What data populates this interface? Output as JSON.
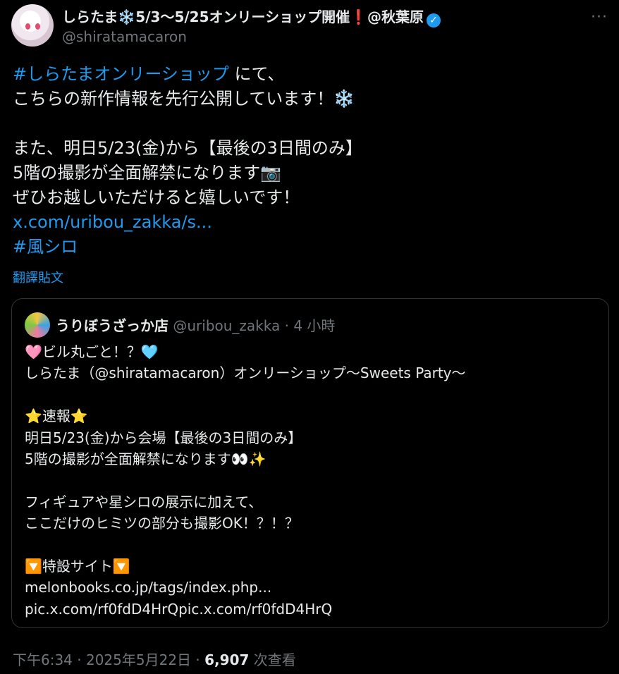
{
  "author": {
    "name": "しらたま❄️5/3～5/25オンリーショップ開催❗️@秋葉原",
    "handle": "@shiratamacaron",
    "more_icon": "more-dots-icon"
  },
  "tweet": {
    "lines": [
      {
        "type": "mixed",
        "link": "#しらたまオンリーショップ",
        "text": " にて、"
      },
      {
        "type": "text",
        "text": "こちらの新作情報を先行公開しています！❄️"
      },
      {
        "type": "blank",
        "text": ""
      },
      {
        "type": "text",
        "text": "また、明日5/23(金)から【最後の3日間のみ】"
      },
      {
        "type": "text",
        "text": "5階の撮影が全面解禁になります📷"
      },
      {
        "type": "text",
        "text": "ぜひお越しいただけると嬉しいです！"
      },
      {
        "type": "link",
        "text": "x.com/uribou_zakka/s..."
      },
      {
        "type": "link",
        "text": "#風シロ"
      }
    ],
    "translate": "翻譯貼文"
  },
  "quote": {
    "name": "うりぼうざっか店",
    "handle": "@uribou_zakka",
    "time": " · 4 小時",
    "lines": [
      "🩷ビル丸ごと！？🩵",
      "しらたま（@shiratamacaron）オンリーショップ～Sweets Party～",
      "",
      "⭐速報⭐",
      "明日5/23(金)から会場【最後の3日間のみ】",
      "5階の撮影が全面解禁になります👀✨",
      "",
      "フィギュアや星シロの展示に加えて、",
      "ここだけのヒミツの部分も撮影OK！？！？",
      "",
      "🔽特設サイト🔽",
      "melonbooks.co.jp/tags/index.php...",
      "pic.x.com/rf0fdD4HrQpic.x.com/rf0fdD4HrQ"
    ]
  },
  "footer": {
    "time": "下午6:34 · 2025年5月22日 · ",
    "views": "6,907",
    "views_label": " 次查看"
  },
  "colors": {
    "link": "#1d9bf0",
    "muted": "#71767b",
    "text": "#e7e9ea",
    "border": "#2f3336"
  }
}
